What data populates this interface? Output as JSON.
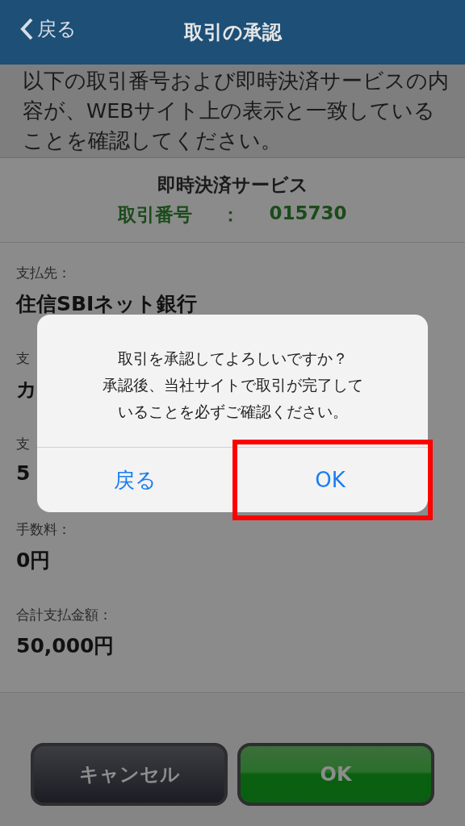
{
  "nav": {
    "back": "戻る",
    "title": "取引の承認"
  },
  "intro": "以下の取引番号および即時決済サービスの内容が、WEBサイト上の表示と一致していることを確認してください。",
  "service": {
    "name": "即時決済サービス",
    "number_label": "取引番号",
    "separator": "：",
    "number": "015730"
  },
  "details": [
    {
      "label": "支払先：",
      "value": "住信SBIネット銀行"
    },
    {
      "label": "支",
      "value": "カ"
    },
    {
      "label": "支",
      "value": "5"
    },
    {
      "label": "手数料：",
      "value": "0円"
    },
    {
      "label": "合計支払金額：",
      "value": "50,000円"
    }
  ],
  "buttons": [
    {
      "label": "キャンセル",
      "kind": "cancel"
    },
    {
      "label": "OK",
      "kind": "confirm"
    }
  ],
  "dialog": {
    "message": [
      "取引を承認してよろしいですか？",
      "承認後、当社サイトで取引が完了して",
      "いることを必ずご確認ください。"
    ],
    "actions": [
      {
        "label": "戻る",
        "highlighted": false
      },
      {
        "label": "OK",
        "highlighted": true
      }
    ]
  }
}
